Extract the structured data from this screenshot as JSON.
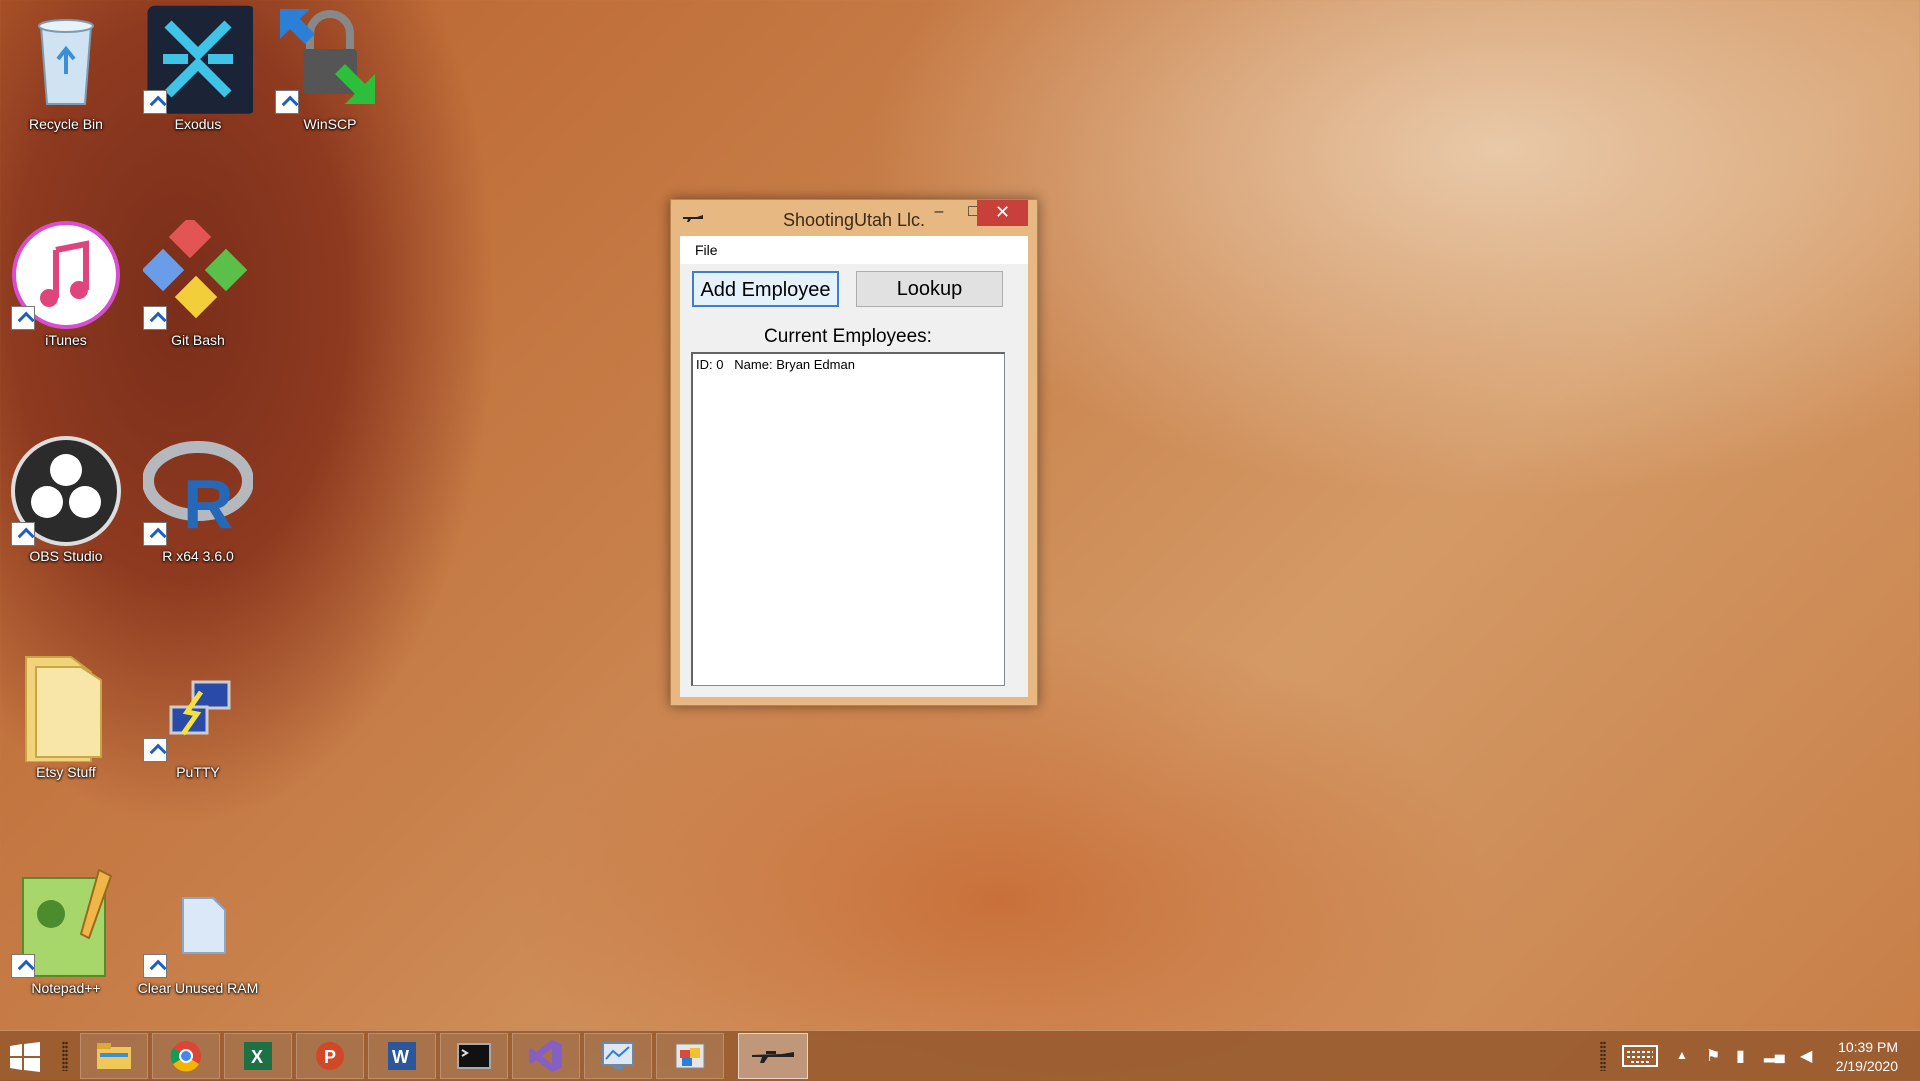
{
  "desktop": {
    "icons": [
      {
        "label": "Recycle Bin"
      },
      {
        "label": "Exodus"
      },
      {
        "label": "WinSCP"
      },
      {
        "label": "iTunes"
      },
      {
        "label": "Git Bash"
      },
      {
        "label": "OBS Studio"
      },
      {
        "label": "R x64 3.6.0"
      },
      {
        "label": "Etsy Stuff"
      },
      {
        "label": "PuTTY"
      },
      {
        "label": "Notepad++"
      },
      {
        "label": "Clear Unused RAM"
      }
    ]
  },
  "window": {
    "title": "ShootingUtah Llc.",
    "menu": {
      "file": "File"
    },
    "buttons": {
      "add": "Add Employee",
      "lookup": "Lookup"
    },
    "employees_label": "Current Employees:",
    "employees": [
      "ID: 0   Name: Bryan Edman"
    ],
    "colors": {
      "frame": "#e7b881",
      "close": "#c7413a",
      "focus": "#3c7fd0"
    }
  },
  "taskbar": {
    "apps": [
      "file-explorer",
      "chrome",
      "excel",
      "powerpoint",
      "word",
      "command-prompt",
      "visual-studio",
      "performance-monitor",
      "control-panel",
      "shootingutah-app"
    ],
    "clock": {
      "time": "10:39 PM",
      "date": "2/19/2020"
    }
  }
}
